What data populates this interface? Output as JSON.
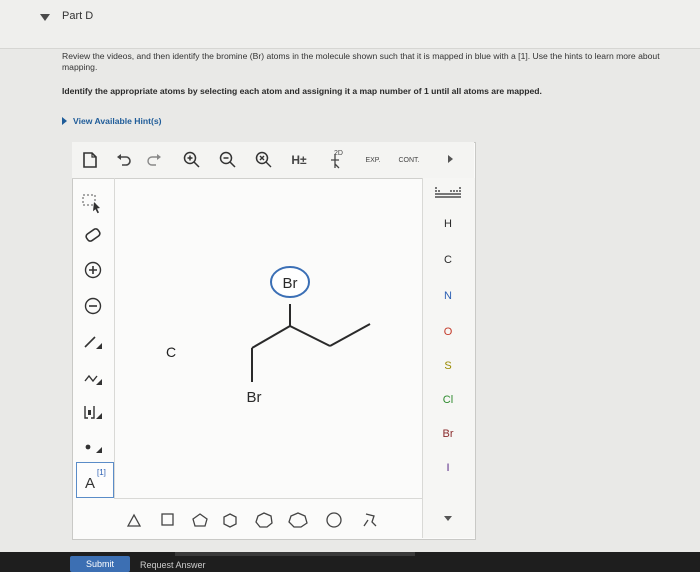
{
  "part": {
    "title": "Part D"
  },
  "question": {
    "text": "Review the videos, and then identify the bromine (Br) atoms in the molecule shown such that it is mapped in blue with a [1]. Use the hints to learn more about mapping.",
    "instruction": "Identify the appropriate atoms by selecting each atom and assigning it a map number of 1 until all atoms are mapped."
  },
  "hints": {
    "label": "View Available Hint(s)"
  },
  "editor": {
    "top_toolbar": {
      "hplus": "H±",
      "twod": "2D",
      "exp": "EXP.",
      "cont": "CONT."
    },
    "left_toolbar": {
      "charge_label": "A",
      "map_label": "[1]"
    },
    "elements": [
      "H",
      "C",
      "N",
      "O",
      "S",
      "Cl",
      "Br",
      "I"
    ],
    "element_colors": {
      "H": "#333333",
      "C": "#333333",
      "N": "#2b5fb3",
      "O": "#c43b2b",
      "S": "#9a8a00",
      "Cl": "#2e8b2e",
      "Br": "#8a2b2b",
      "I": "#5a2b8a"
    },
    "canvas": {
      "stray_label": "C",
      "atoms": {
        "br_top": "Br",
        "br_bottom": "Br"
      },
      "highlight_color": "#3b6fb5"
    }
  },
  "actions": {
    "submit": "Submit",
    "request": "Request Answer"
  }
}
